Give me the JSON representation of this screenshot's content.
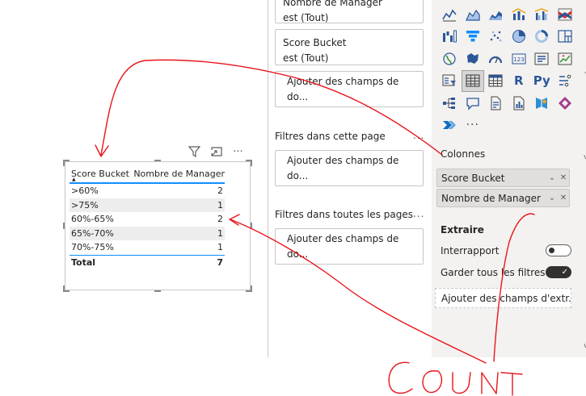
{
  "visual": {
    "table": {
      "columns": [
        "Score Bucket",
        "Nombre de Manager"
      ],
      "sort_indicator": "▲",
      "rows": [
        {
          "bucket": ">60%",
          "count": "2"
        },
        {
          "bucket": ">75%",
          "count": "1"
        },
        {
          "bucket": "60%-65%",
          "count": "2"
        },
        {
          "bucket": "65%-70%",
          "count": "1"
        },
        {
          "bucket": "70%-75%",
          "count": "1"
        }
      ],
      "total": {
        "label": "Total",
        "value": "7"
      }
    },
    "tool_icons": [
      "filter-icon",
      "focus-mode-icon",
      "more-options-icon"
    ],
    "more_label": "···"
  },
  "filters": {
    "cards": [
      {
        "title": "Nombre de Manager",
        "value": "est (Tout)"
      },
      {
        "title": "Score Bucket",
        "value": "est (Tout)"
      }
    ],
    "add_fields_label": "Ajouter des champs de do...",
    "page_section": "Filtres dans cette page",
    "all_pages_section": "Filtres dans toutes les pages",
    "section_more": "..."
  },
  "visualizations": {
    "more_visuals": "···",
    "r_label": "R",
    "py_label": "Py",
    "columns_label": "Colonnes",
    "column_fields": [
      "Score Bucket",
      "Nombre de Manager"
    ],
    "extract_label": "Extraire",
    "cross_report_label": "Interrapport",
    "cross_report_state": "off",
    "keep_filters_label": "Garder tous les filtres",
    "keep_filters_state": "on",
    "drill_well_placeholder": "Ajouter des champs d'extr...",
    "scroll_up": "^",
    "scroll_down": "v"
  },
  "annotations": {
    "handwritten_text": "COUNT",
    "color": "#e8151b"
  },
  "colors": {
    "accent": "#118dff",
    "pane_bg": "#f3f2f1",
    "pill_bg": "#e1dfdd"
  }
}
